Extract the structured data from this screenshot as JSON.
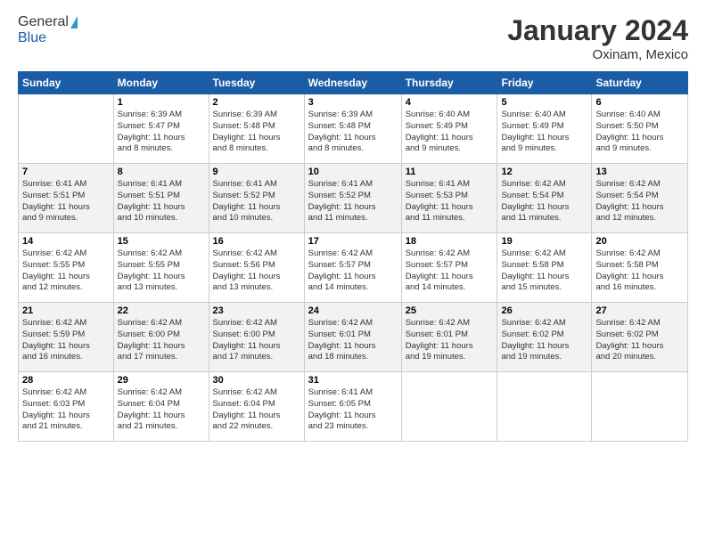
{
  "logo": {
    "general": "General",
    "blue": "Blue"
  },
  "title": "January 2024",
  "location": "Oxinam, Mexico",
  "days_header": [
    "Sunday",
    "Monday",
    "Tuesday",
    "Wednesday",
    "Thursday",
    "Friday",
    "Saturday"
  ],
  "weeks": [
    [
      {
        "day": "",
        "info": ""
      },
      {
        "day": "1",
        "info": "Sunrise: 6:39 AM\nSunset: 5:47 PM\nDaylight: 11 hours\nand 8 minutes."
      },
      {
        "day": "2",
        "info": "Sunrise: 6:39 AM\nSunset: 5:48 PM\nDaylight: 11 hours\nand 8 minutes."
      },
      {
        "day": "3",
        "info": "Sunrise: 6:39 AM\nSunset: 5:48 PM\nDaylight: 11 hours\nand 8 minutes."
      },
      {
        "day": "4",
        "info": "Sunrise: 6:40 AM\nSunset: 5:49 PM\nDaylight: 11 hours\nand 9 minutes."
      },
      {
        "day": "5",
        "info": "Sunrise: 6:40 AM\nSunset: 5:49 PM\nDaylight: 11 hours\nand 9 minutes."
      },
      {
        "day": "6",
        "info": "Sunrise: 6:40 AM\nSunset: 5:50 PM\nDaylight: 11 hours\nand 9 minutes."
      }
    ],
    [
      {
        "day": "7",
        "info": "Sunrise: 6:41 AM\nSunset: 5:51 PM\nDaylight: 11 hours\nand 9 minutes."
      },
      {
        "day": "8",
        "info": "Sunrise: 6:41 AM\nSunset: 5:51 PM\nDaylight: 11 hours\nand 10 minutes."
      },
      {
        "day": "9",
        "info": "Sunrise: 6:41 AM\nSunset: 5:52 PM\nDaylight: 11 hours\nand 10 minutes."
      },
      {
        "day": "10",
        "info": "Sunrise: 6:41 AM\nSunset: 5:52 PM\nDaylight: 11 hours\nand 11 minutes."
      },
      {
        "day": "11",
        "info": "Sunrise: 6:41 AM\nSunset: 5:53 PM\nDaylight: 11 hours\nand 11 minutes."
      },
      {
        "day": "12",
        "info": "Sunrise: 6:42 AM\nSunset: 5:54 PM\nDaylight: 11 hours\nand 11 minutes."
      },
      {
        "day": "13",
        "info": "Sunrise: 6:42 AM\nSunset: 5:54 PM\nDaylight: 11 hours\nand 12 minutes."
      }
    ],
    [
      {
        "day": "14",
        "info": "Sunrise: 6:42 AM\nSunset: 5:55 PM\nDaylight: 11 hours\nand 12 minutes."
      },
      {
        "day": "15",
        "info": "Sunrise: 6:42 AM\nSunset: 5:55 PM\nDaylight: 11 hours\nand 13 minutes."
      },
      {
        "day": "16",
        "info": "Sunrise: 6:42 AM\nSunset: 5:56 PM\nDaylight: 11 hours\nand 13 minutes."
      },
      {
        "day": "17",
        "info": "Sunrise: 6:42 AM\nSunset: 5:57 PM\nDaylight: 11 hours\nand 14 minutes."
      },
      {
        "day": "18",
        "info": "Sunrise: 6:42 AM\nSunset: 5:57 PM\nDaylight: 11 hours\nand 14 minutes."
      },
      {
        "day": "19",
        "info": "Sunrise: 6:42 AM\nSunset: 5:58 PM\nDaylight: 11 hours\nand 15 minutes."
      },
      {
        "day": "20",
        "info": "Sunrise: 6:42 AM\nSunset: 5:58 PM\nDaylight: 11 hours\nand 16 minutes."
      }
    ],
    [
      {
        "day": "21",
        "info": "Sunrise: 6:42 AM\nSunset: 5:59 PM\nDaylight: 11 hours\nand 16 minutes."
      },
      {
        "day": "22",
        "info": "Sunrise: 6:42 AM\nSunset: 6:00 PM\nDaylight: 11 hours\nand 17 minutes."
      },
      {
        "day": "23",
        "info": "Sunrise: 6:42 AM\nSunset: 6:00 PM\nDaylight: 11 hours\nand 17 minutes."
      },
      {
        "day": "24",
        "info": "Sunrise: 6:42 AM\nSunset: 6:01 PM\nDaylight: 11 hours\nand 18 minutes."
      },
      {
        "day": "25",
        "info": "Sunrise: 6:42 AM\nSunset: 6:01 PM\nDaylight: 11 hours\nand 19 minutes."
      },
      {
        "day": "26",
        "info": "Sunrise: 6:42 AM\nSunset: 6:02 PM\nDaylight: 11 hours\nand 19 minutes."
      },
      {
        "day": "27",
        "info": "Sunrise: 6:42 AM\nSunset: 6:02 PM\nDaylight: 11 hours\nand 20 minutes."
      }
    ],
    [
      {
        "day": "28",
        "info": "Sunrise: 6:42 AM\nSunset: 6:03 PM\nDaylight: 11 hours\nand 21 minutes."
      },
      {
        "day": "29",
        "info": "Sunrise: 6:42 AM\nSunset: 6:04 PM\nDaylight: 11 hours\nand 21 minutes."
      },
      {
        "day": "30",
        "info": "Sunrise: 6:42 AM\nSunset: 6:04 PM\nDaylight: 11 hours\nand 22 minutes."
      },
      {
        "day": "31",
        "info": "Sunrise: 6:41 AM\nSunset: 6:05 PM\nDaylight: 11 hours\nand 23 minutes."
      },
      {
        "day": "",
        "info": ""
      },
      {
        "day": "",
        "info": ""
      },
      {
        "day": "",
        "info": ""
      }
    ]
  ]
}
